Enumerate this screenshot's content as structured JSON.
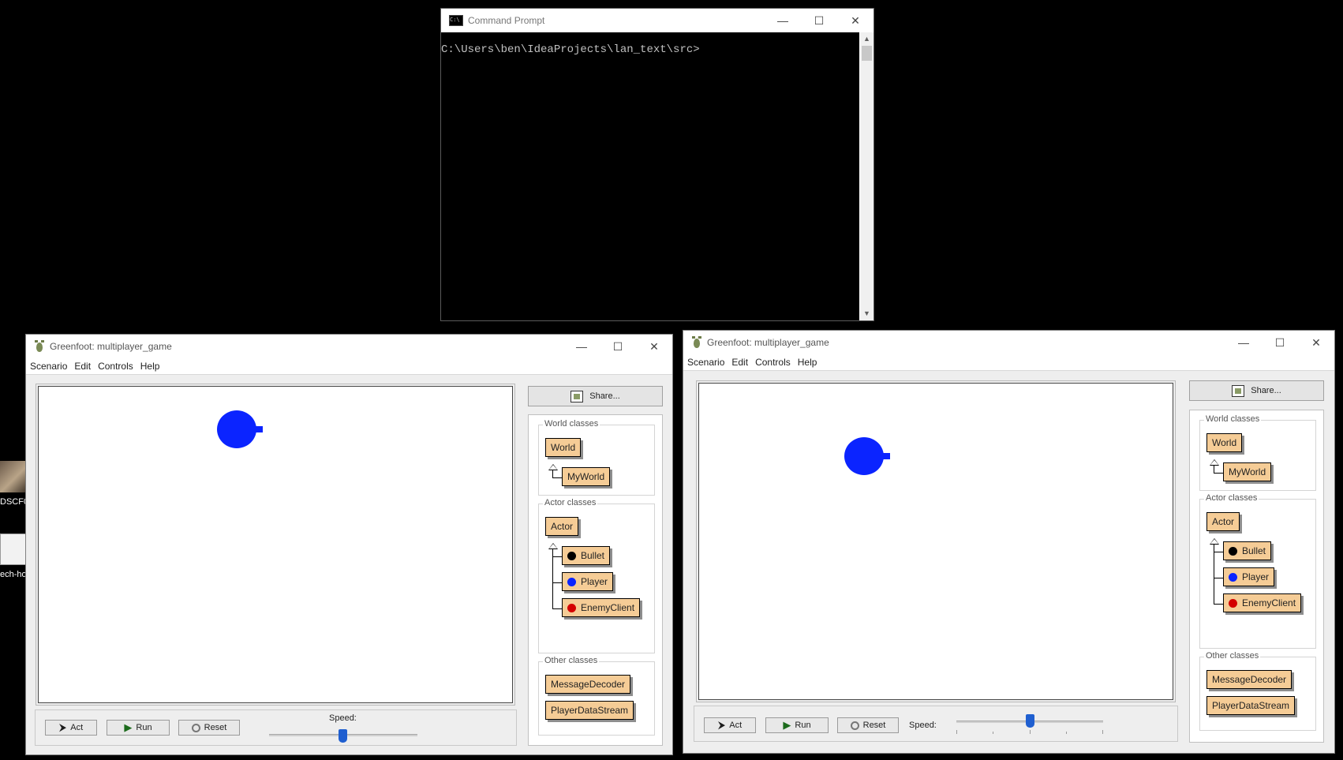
{
  "desktop": {
    "icons": [
      {
        "label": "DSCF0",
        "kind": "photo"
      },
      {
        "label": "ech-ho",
        "kind": "document"
      }
    ]
  },
  "cmd": {
    "title": "Command Prompt",
    "prompt": "C:\\Users\\ben\\IdeaProjects\\lan_text\\src>"
  },
  "window_controls": {
    "minimize": "—",
    "maximize": "☐",
    "close": "✕"
  },
  "greenfoot": {
    "title": "Greenfoot: multiplayer_game",
    "menu": [
      "Scenario",
      "Edit",
      "Controls",
      "Help"
    ],
    "share_label": "Share...",
    "groups": {
      "world": "World classes",
      "actor": "Actor classes",
      "other": "Other classes"
    },
    "world_classes": [
      "World",
      "MyWorld"
    ],
    "actor_classes": [
      {
        "name": "Actor"
      },
      {
        "name": "Bullet",
        "icon": "black-dot",
        "color": "#000000"
      },
      {
        "name": "Player",
        "icon": "blue-player",
        "color": "#0b24ff"
      },
      {
        "name": "EnemyClient",
        "icon": "red-player",
        "color": "#d40000"
      }
    ],
    "other_classes": [
      "MessageDecoder",
      "PlayerDataStream"
    ],
    "controls": {
      "act": "Act",
      "run": "Run",
      "reset": "Reset",
      "speed": "Speed:"
    }
  },
  "windows": [
    {
      "id": "left",
      "speed_fraction": 0.5
    },
    {
      "id": "right",
      "speed_fraction": 0.5
    }
  ]
}
